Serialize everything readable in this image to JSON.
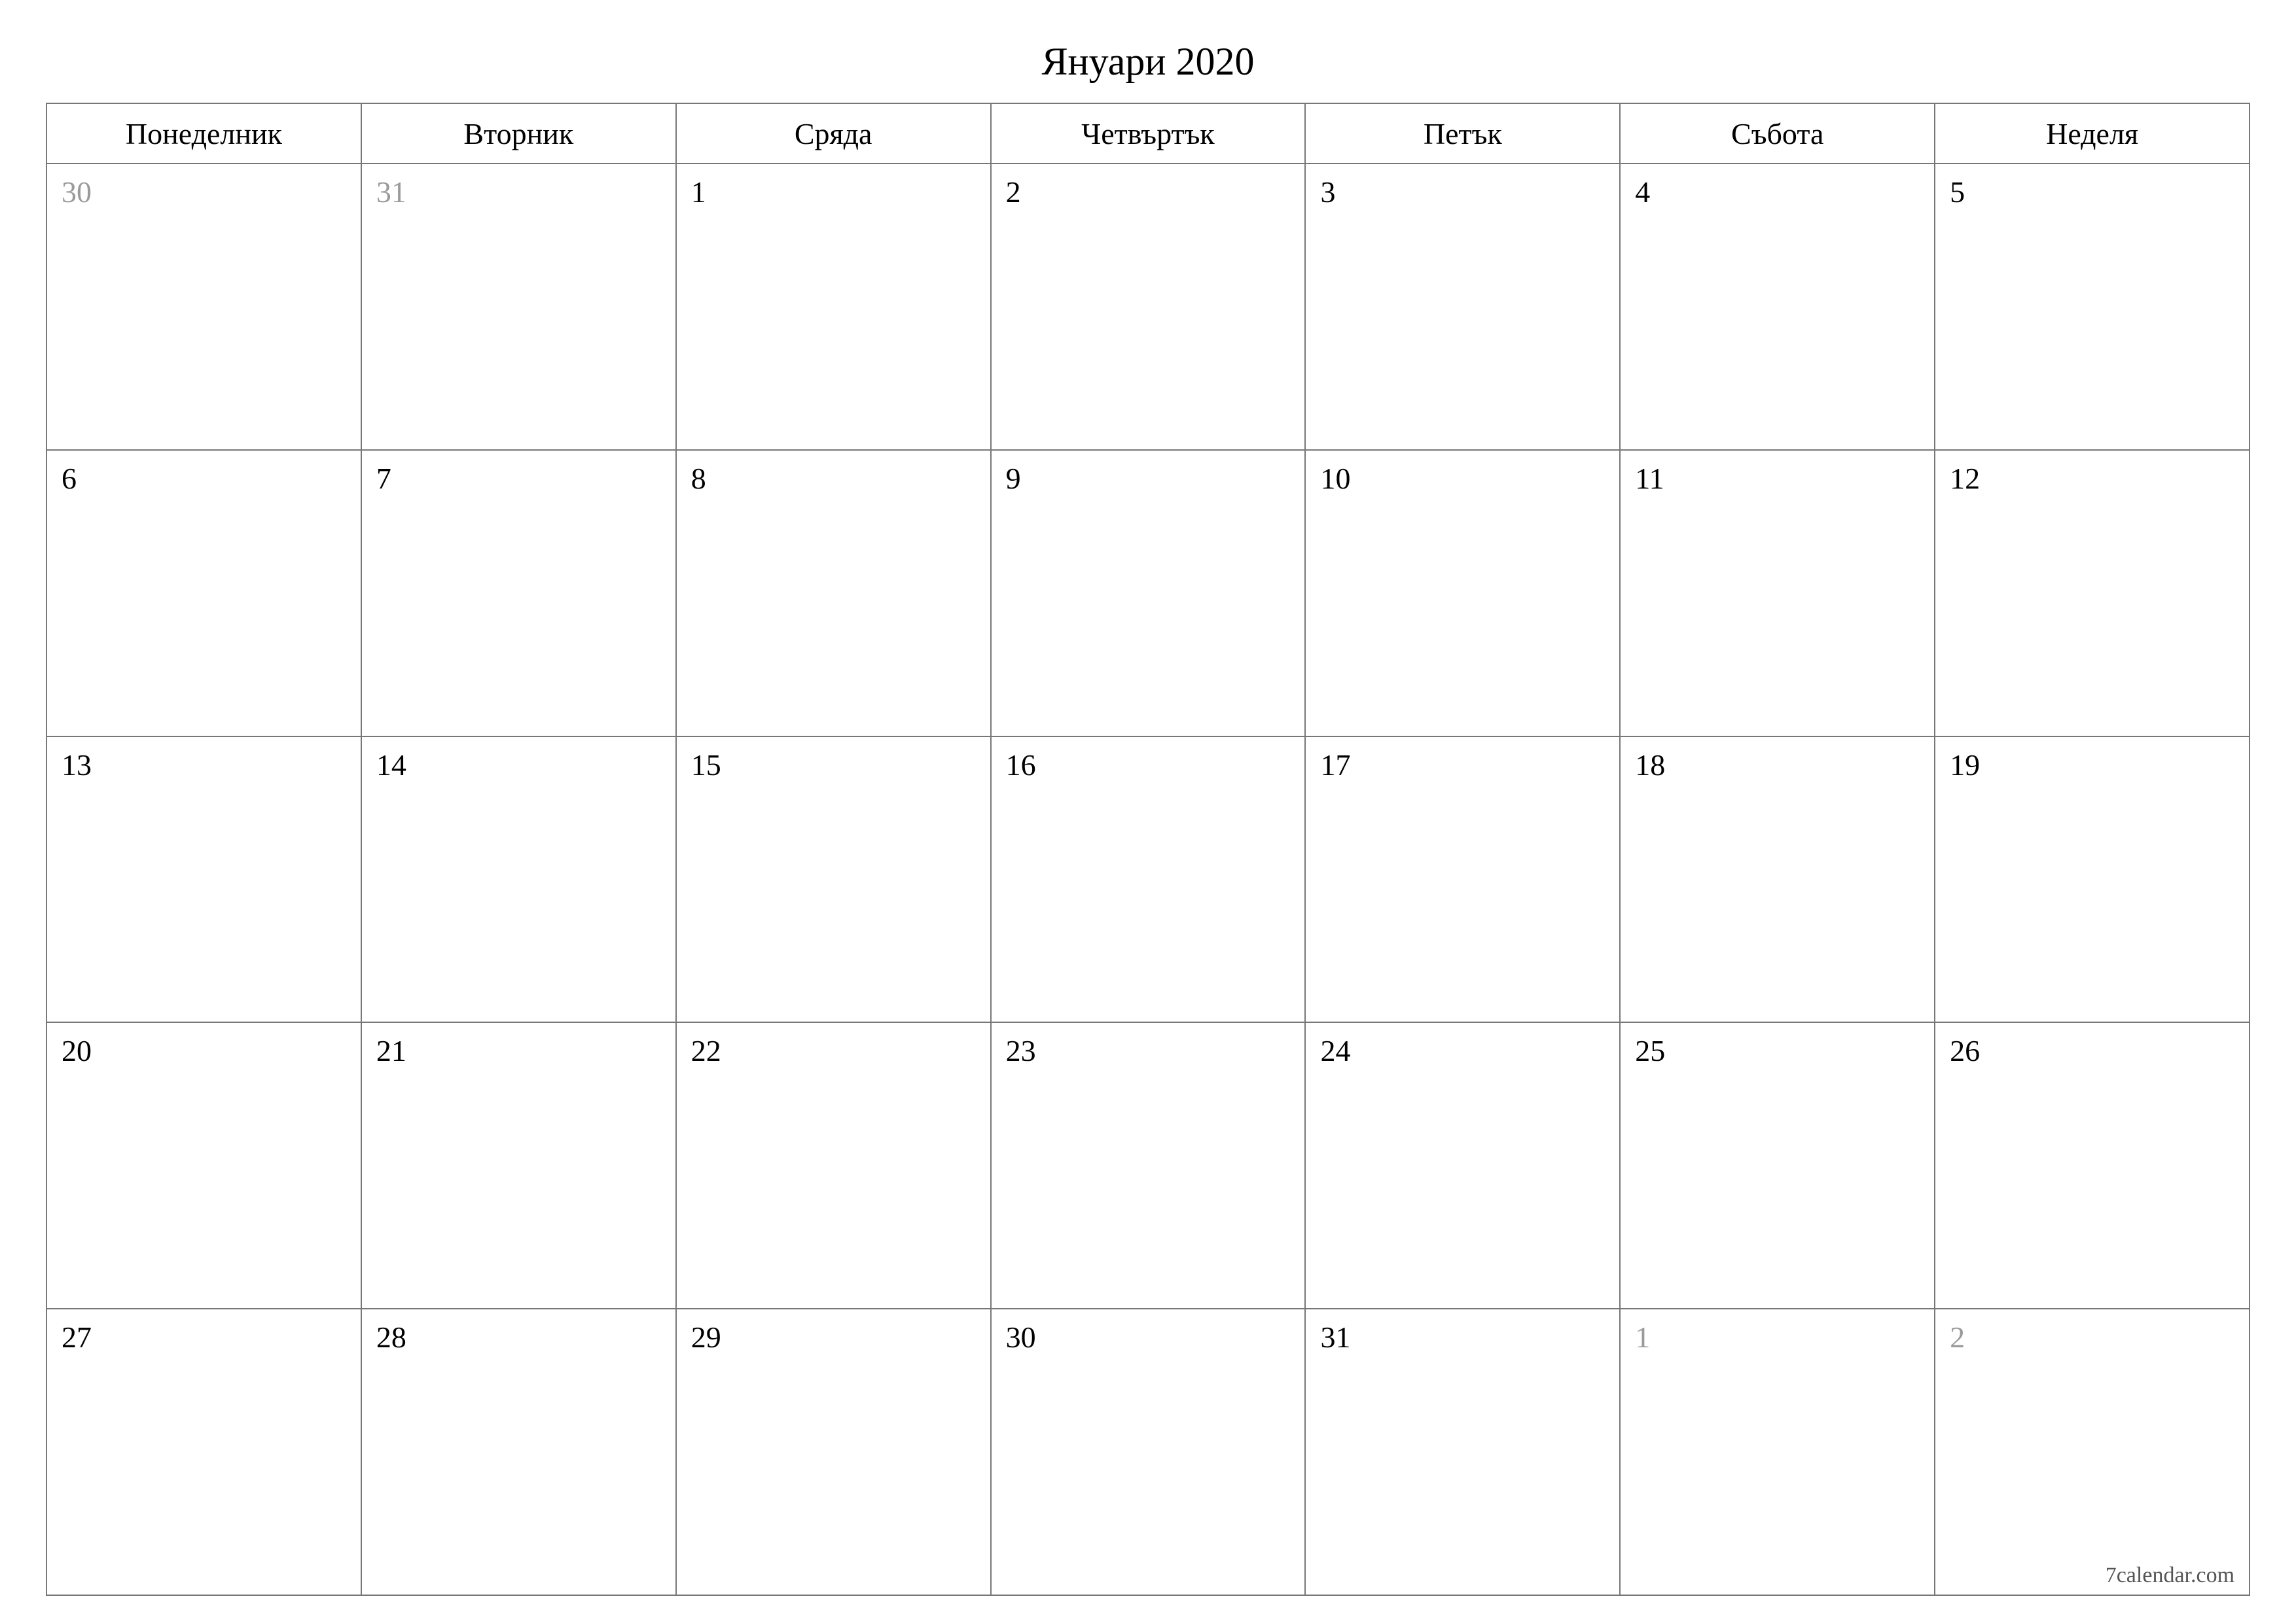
{
  "title": "Януари 2020",
  "weekdays": [
    "Понеделник",
    "Вторник",
    "Сряда",
    "Четвъртък",
    "Петък",
    "Събота",
    "Неделя"
  ],
  "weeks": [
    [
      {
        "day": "30",
        "other": true
      },
      {
        "day": "31",
        "other": true
      },
      {
        "day": "1",
        "other": false
      },
      {
        "day": "2",
        "other": false
      },
      {
        "day": "3",
        "other": false
      },
      {
        "day": "4",
        "other": false
      },
      {
        "day": "5",
        "other": false
      }
    ],
    [
      {
        "day": "6",
        "other": false
      },
      {
        "day": "7",
        "other": false
      },
      {
        "day": "8",
        "other": false
      },
      {
        "day": "9",
        "other": false
      },
      {
        "day": "10",
        "other": false
      },
      {
        "day": "11",
        "other": false
      },
      {
        "day": "12",
        "other": false
      }
    ],
    [
      {
        "day": "13",
        "other": false
      },
      {
        "day": "14",
        "other": false
      },
      {
        "day": "15",
        "other": false
      },
      {
        "day": "16",
        "other": false
      },
      {
        "day": "17",
        "other": false
      },
      {
        "day": "18",
        "other": false
      },
      {
        "day": "19",
        "other": false
      }
    ],
    [
      {
        "day": "20",
        "other": false
      },
      {
        "day": "21",
        "other": false
      },
      {
        "day": "22",
        "other": false
      },
      {
        "day": "23",
        "other": false
      },
      {
        "day": "24",
        "other": false
      },
      {
        "day": "25",
        "other": false
      },
      {
        "day": "26",
        "other": false
      }
    ],
    [
      {
        "day": "27",
        "other": false
      },
      {
        "day": "28",
        "other": false
      },
      {
        "day": "29",
        "other": false
      },
      {
        "day": "30",
        "other": false
      },
      {
        "day": "31",
        "other": false
      },
      {
        "day": "1",
        "other": true
      },
      {
        "day": "2",
        "other": true
      }
    ]
  ],
  "footer": "7calendar.com"
}
